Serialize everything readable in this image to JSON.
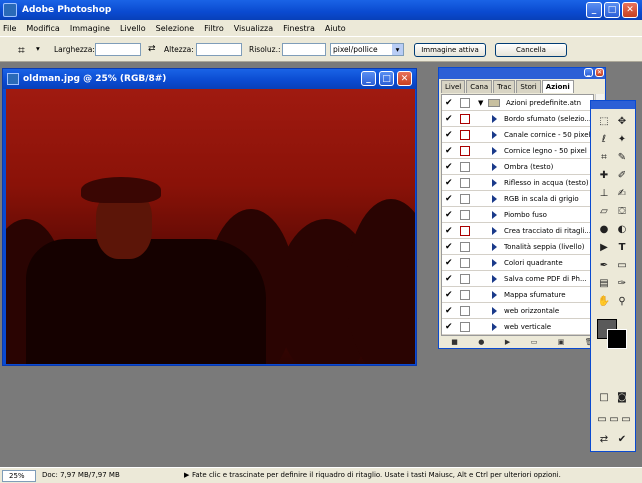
{
  "app": {
    "title": "Adobe Photoshop"
  },
  "menu": [
    "File",
    "Modifica",
    "Immagine",
    "Livello",
    "Selezione",
    "Filtro",
    "Visualizza",
    "Finestra",
    "Aiuto"
  ],
  "options": {
    "width_label": "Larghezza:",
    "height_label": "Altezza:",
    "resolution_label": "Risoluz.:",
    "unit_value": "pixel/pollice",
    "front_image_button": "Immagine attiva",
    "clear_button": "Cancella"
  },
  "document": {
    "title": "oldman.jpg @ 25% (RGB/8#)"
  },
  "panel": {
    "tabs": [
      "Livel",
      "Cana",
      "Trac",
      "Stori",
      "Azioni"
    ],
    "active_tab": "Azioni",
    "set_name": "Azioni predefinite.atn",
    "actions": [
      "Bordo sfumato (selezio...",
      "Canale cornice - 50 pixel",
      "Cornice legno - 50 pixel",
      "Ombra (testo)",
      "Riflesso in acqua (testo)",
      "RGB in scala di grigio",
      "Piombo fuso",
      "Crea tracciato di ritagli...",
      "Tonalità seppia (livello)",
      "Colori quadrante",
      "Salva come PDF di Ph...",
      "Mappa sfumature",
      "web orizzontale",
      "web verticale"
    ]
  },
  "status": {
    "zoom": "25%",
    "doc_info": "Doc: 7,97 MB/7,97 MB",
    "message": "Fate clic e trascinate per definire il riquadro di ritaglio. Usate i tasti Maiusc, Alt e Ctrl per ulteriori opzioni."
  },
  "icons": {
    "logo": "photoshop-logo",
    "crop_tool": "crop-icon",
    "swap": "swap-arrows-icon"
  }
}
